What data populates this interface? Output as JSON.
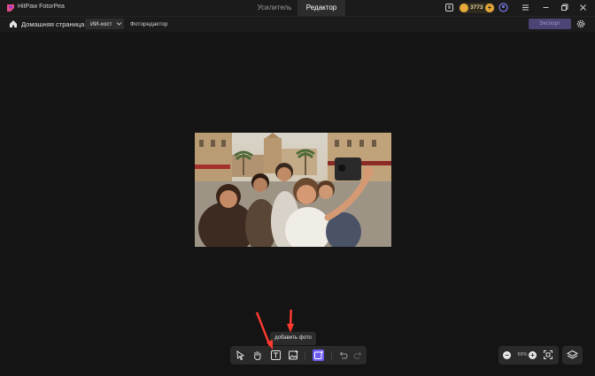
{
  "app": {
    "name": "HitPaw FotorPea"
  },
  "tabs": [
    {
      "label": "Усилитель",
      "active": false
    },
    {
      "label": "Редактор",
      "active": true
    }
  ],
  "titlebar_icons": [
    "history-icon",
    "account-icon",
    "menu-icon",
    "minimize-icon",
    "restore-icon",
    "close-icon"
  ],
  "coins": {
    "count": "3773",
    "plus": "+"
  },
  "subbar": {
    "home_label": "Домашняя страница",
    "ai_tag": "ИИ-хост",
    "crumb": "Фоторедактор",
    "export_label": "Экспорт"
  },
  "canvas": {
    "image": "group-selfie-photo"
  },
  "tooltip": "добавить фото",
  "toolbar": {
    "tools": [
      "select-tool",
      "hand-tool",
      "text-tool",
      "add-photo-tool",
      "ai-generate-tool",
      "undo",
      "redo"
    ],
    "active_tool": "ai-generate-tool"
  },
  "zoom": {
    "minus": "−",
    "value": "69%",
    "plus": "+"
  },
  "colors": {
    "accent": "#6d5af5",
    "coin": "#e7a93c",
    "background": "#141414",
    "annotation_arrow": "#ff3b30"
  }
}
